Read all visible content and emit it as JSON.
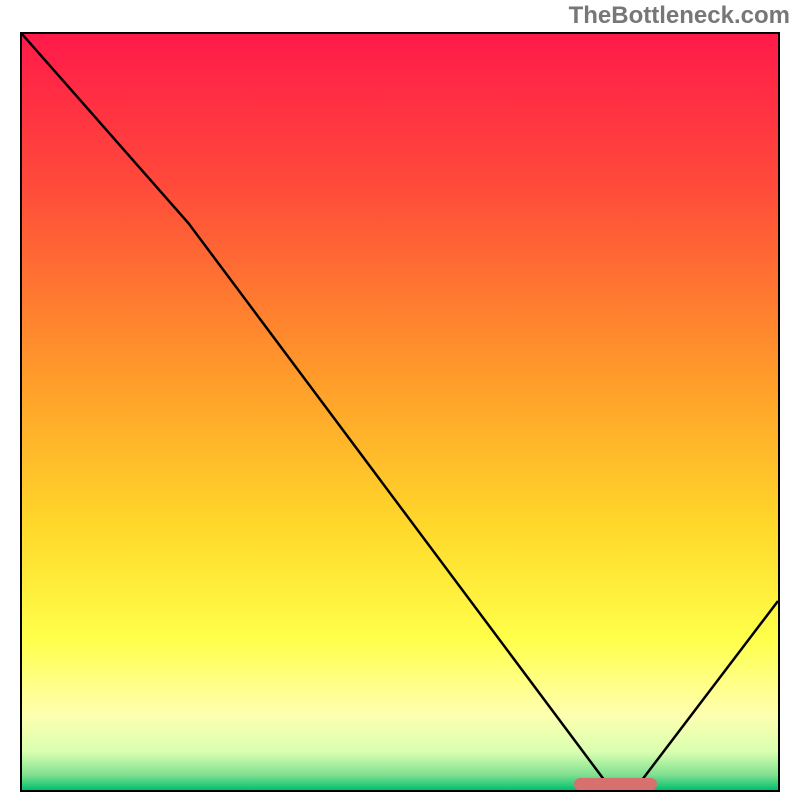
{
  "watermark": "TheBottleneck.com",
  "chart_data": {
    "type": "line",
    "title": "",
    "xlabel": "",
    "ylabel": "",
    "xlim": [
      0,
      100
    ],
    "ylim": [
      0,
      100
    ],
    "curve": [
      {
        "x": 0,
        "y": 100
      },
      {
        "x": 22,
        "y": 75
      },
      {
        "x": 78,
        "y": 0
      },
      {
        "x": 81,
        "y": 0
      },
      {
        "x": 100,
        "y": 25
      }
    ],
    "marker": {
      "x_start": 73,
      "x_end": 84,
      "y": 0.8
    },
    "gradient_stops": [
      {
        "offset": 0,
        "color": "#ff1a4a"
      },
      {
        "offset": 20,
        "color": "#ff4a3a"
      },
      {
        "offset": 45,
        "color": "#ff9a2a"
      },
      {
        "offset": 65,
        "color": "#ffd82a"
      },
      {
        "offset": 80,
        "color": "#ffff4a"
      },
      {
        "offset": 90,
        "color": "#ffffb0"
      },
      {
        "offset": 95,
        "color": "#d8ffb0"
      },
      {
        "offset": 98,
        "color": "#80e090"
      },
      {
        "offset": 100,
        "color": "#00c070"
      }
    ]
  }
}
